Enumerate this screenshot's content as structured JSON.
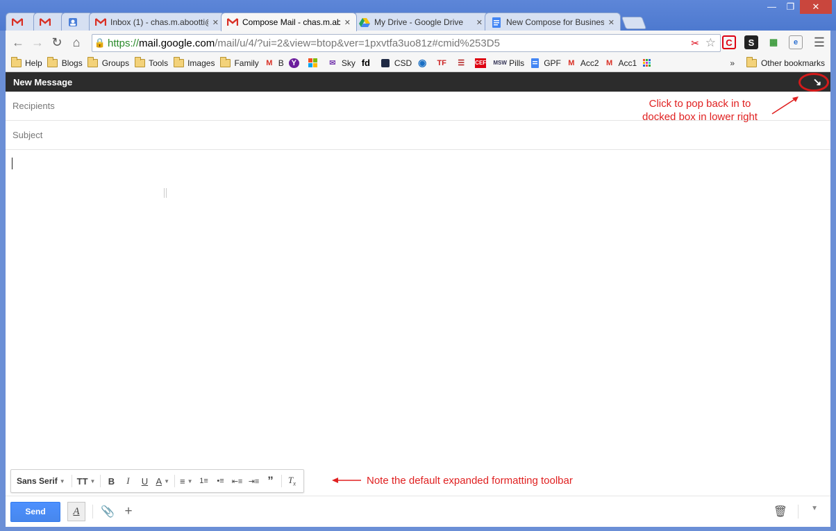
{
  "browser": {
    "tabs": [
      {
        "label": "",
        "icon": "gmail-icon"
      },
      {
        "label": "",
        "icon": "gmail-icon"
      },
      {
        "label": "",
        "icon": "contacts-icon"
      },
      {
        "label": "Inbox (1) - chas.m.abootti@",
        "icon": "gmail-icon"
      },
      {
        "label": "Compose Mail - chas.m.ab",
        "icon": "gmail-icon",
        "active": true
      },
      {
        "label": "My Drive - Google Drive",
        "icon": "drive-icon"
      },
      {
        "label": "New Compose for Business",
        "icon": "docs-icon"
      }
    ],
    "url": {
      "scheme": "https://",
      "host": "mail.google.com",
      "path": "/mail/u/4/?ui=2&view=btop&ver=1pxvtfa3uo81z#cmid%253D5"
    },
    "bookmarks": [
      {
        "label": "Help",
        "icon": "folder-icon"
      },
      {
        "label": "Blogs",
        "icon": "folder-icon"
      },
      {
        "label": "Groups",
        "icon": "folder-icon"
      },
      {
        "label": "Tools",
        "icon": "folder-icon"
      },
      {
        "label": "Images",
        "icon": "folder-icon"
      },
      {
        "label": "Family",
        "icon": "folder-icon"
      },
      {
        "label": "B",
        "icon": "gmail-icon"
      },
      {
        "label": "",
        "icon": "yahoo-icon"
      },
      {
        "label": "",
        "icon": "windows-icon"
      },
      {
        "label": "Sky",
        "icon": "mail-icon"
      },
      {
        "label": "",
        "icon": "fd-icon"
      },
      {
        "label": "CSD",
        "icon": "csd-icon"
      },
      {
        "label": "",
        "icon": "globe-icon"
      },
      {
        "label": "",
        "icon": "tf-icon"
      },
      {
        "label": "",
        "icon": "wave-icon"
      },
      {
        "label": "",
        "icon": "cef-icon"
      },
      {
        "label": "Pills",
        "icon": "msw-icon"
      },
      {
        "label": "GPF",
        "icon": "docs-icon"
      },
      {
        "label": "Acc2",
        "icon": "gmail-icon"
      },
      {
        "label": "Acc1",
        "icon": "gmail-icon"
      },
      {
        "label": "",
        "icon": "grid-icon"
      }
    ],
    "bookmarks_more": "»",
    "other_bookmarks": "Other bookmarks"
  },
  "compose": {
    "title": "New Message",
    "popin_icon": "↘",
    "recipients_placeholder": "Recipients",
    "subject_placeholder": "Subject",
    "send_label": "Send",
    "font_label": "Sans Serif"
  },
  "annotations": {
    "popin_note_line1": "Click to pop back in to",
    "popin_note_line2": "docked box in lower right",
    "toolbar_note": "Note the default expanded formatting toolbar"
  },
  "colors": {
    "send": "#4285f4",
    "annotation": "#e02020",
    "header": "#2c2c2c"
  }
}
